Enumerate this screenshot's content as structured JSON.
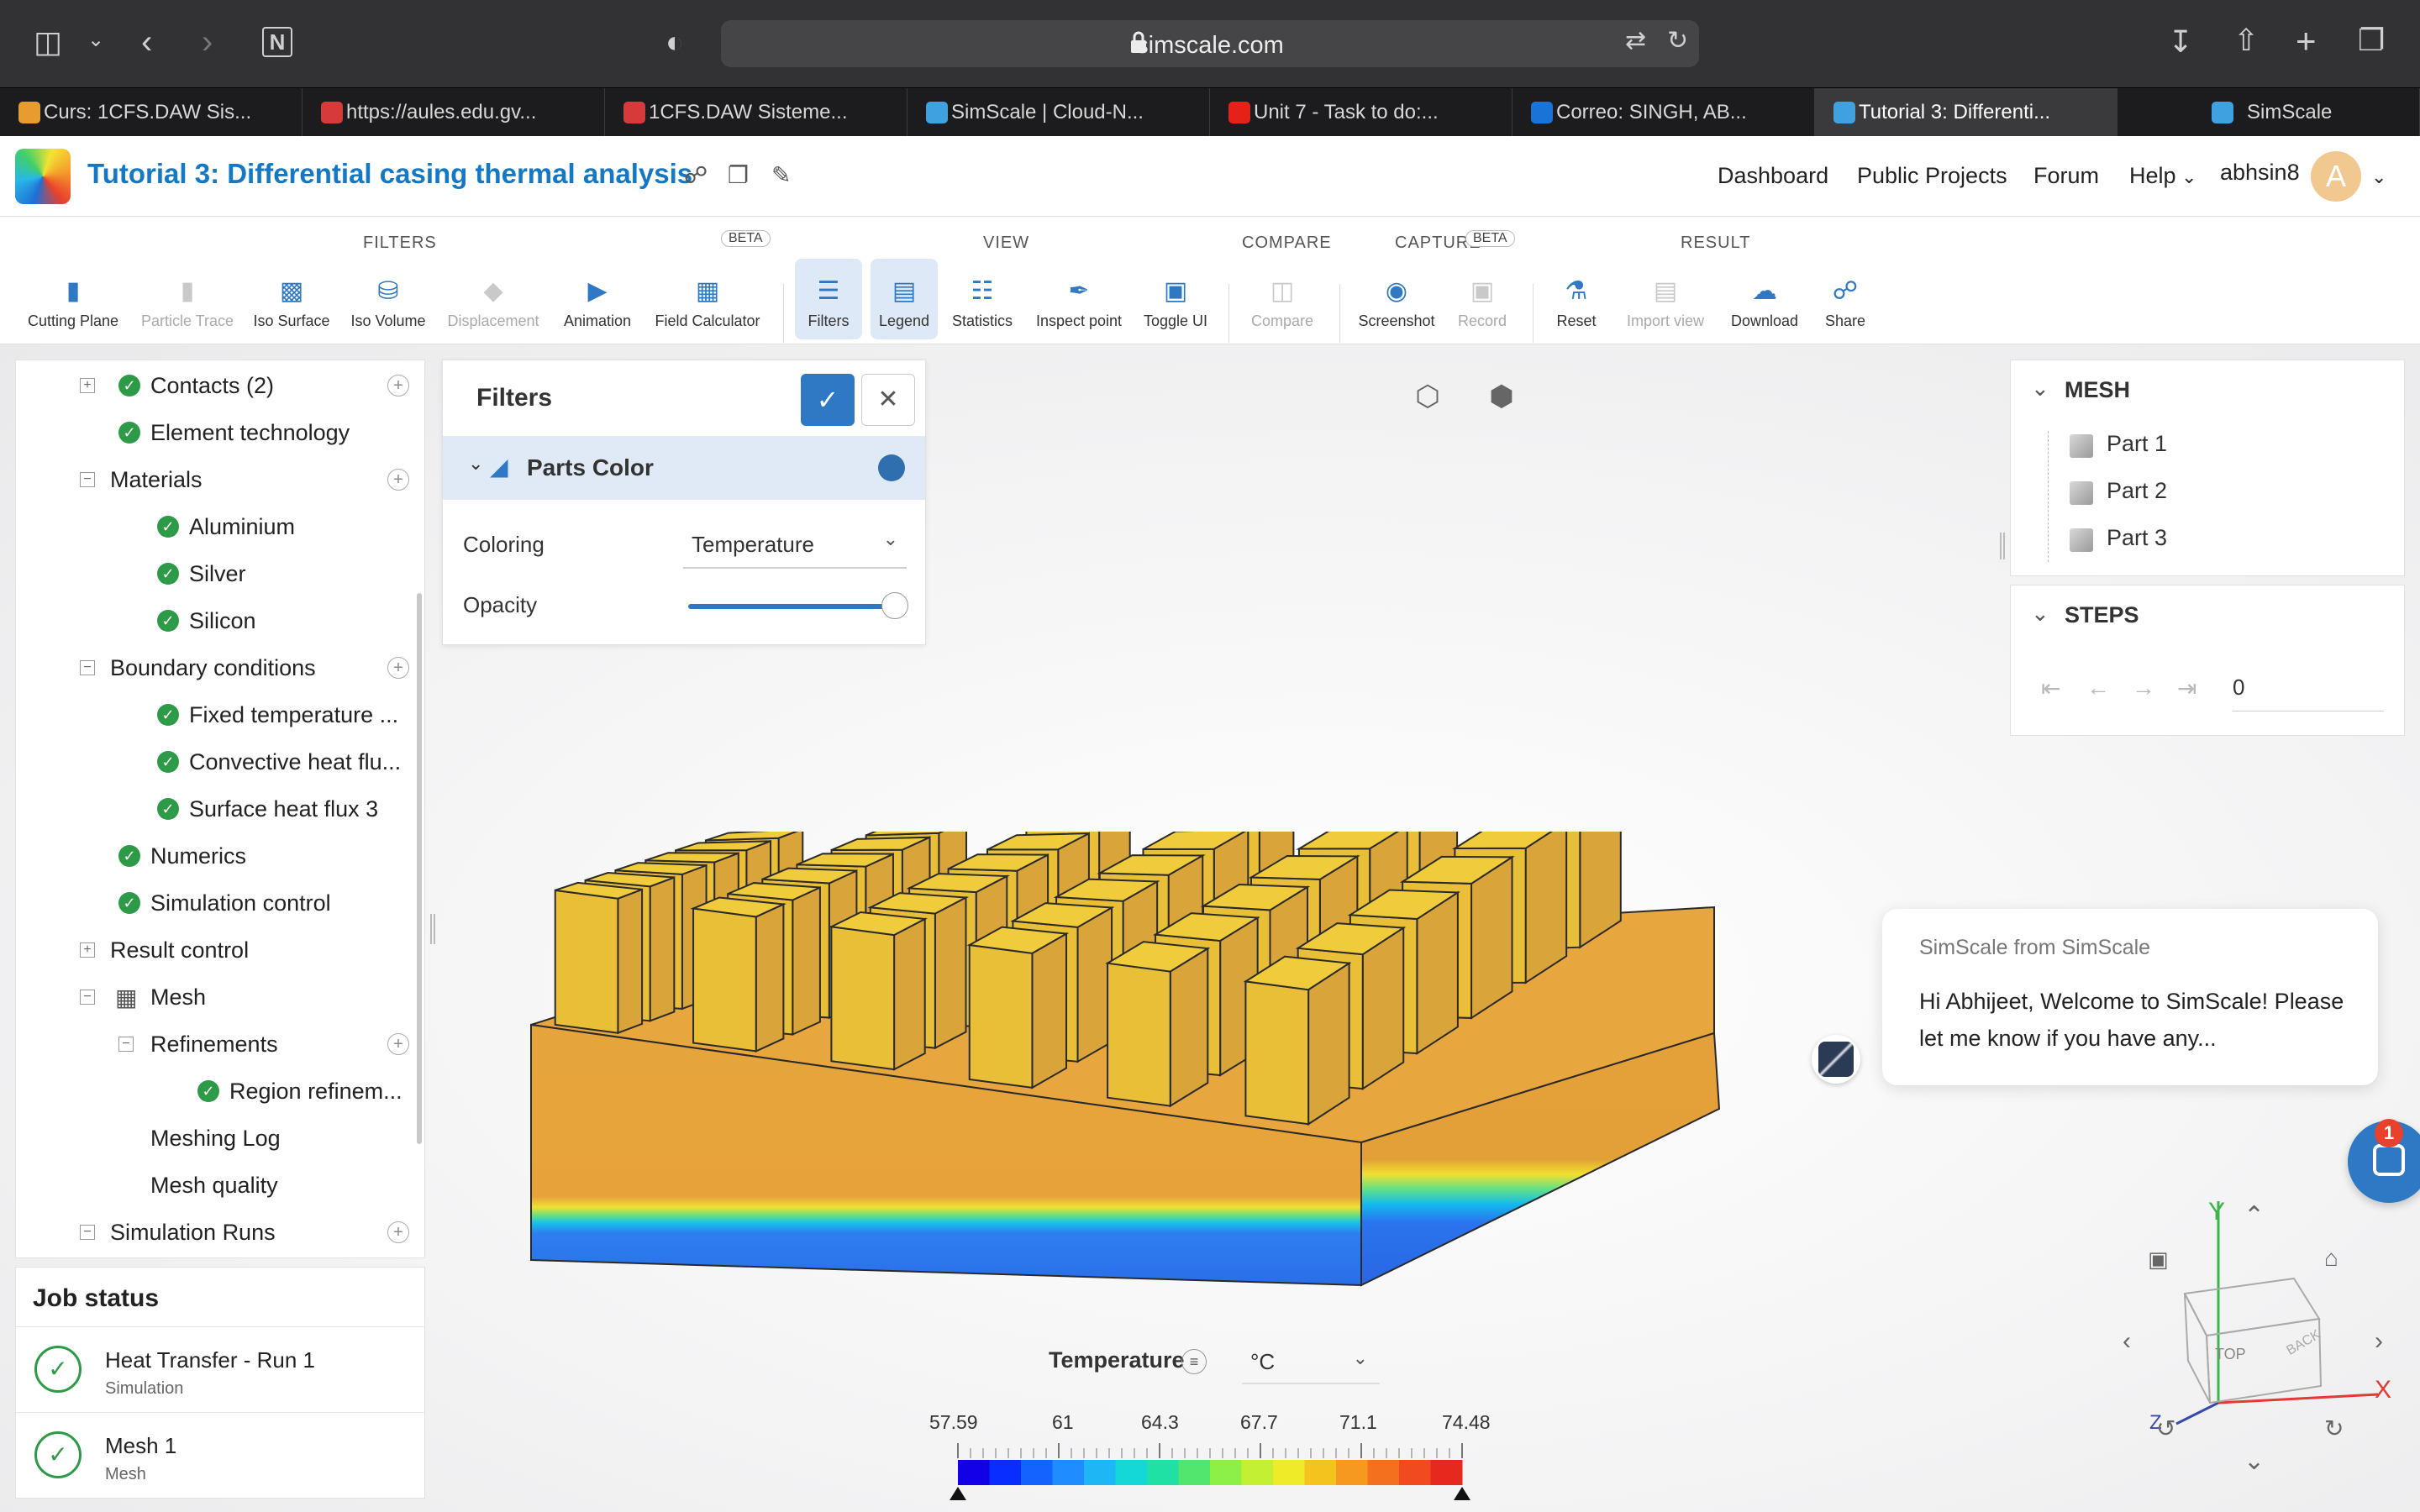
{
  "browser": {
    "url": "simscale.com",
    "tabs": [
      {
        "label": "Curs: 1CFS.DAW Sis...",
        "color": "#e89b2e"
      },
      {
        "label": "https://aules.edu.gv...",
        "color": "#d73a3a"
      },
      {
        "label": "1CFS.DAW Sisteme...",
        "color": "#d73a3a"
      },
      {
        "label": "SimScale | Cloud-N...",
        "color": "#3fa1e0"
      },
      {
        "label": "Unit 7 - Task to do:...",
        "color": "#e62117"
      },
      {
        "label": "Correo: SINGH, AB...",
        "color": "#1a73d6"
      },
      {
        "label": "Tutorial 3: Differenti...",
        "color": "#3fa1e0"
      },
      {
        "label": "SimScale",
        "color": "#3fa1e0"
      }
    ],
    "active_tab_index": 6
  },
  "header": {
    "title": "Tutorial 3: Differential casing thermal analysis",
    "nav": [
      "Dashboard",
      "Public Projects",
      "Forum",
      "Help"
    ],
    "username": "abhsin8",
    "avatar_letter": "A"
  },
  "toolbar": {
    "groups": {
      "filters": "FILTERS",
      "view": "VIEW",
      "compare": "COMPARE",
      "capture": "CAPTURE",
      "result": "RESULT"
    },
    "beta": "BETA",
    "tools": {
      "cutting_plane": "Cutting Plane",
      "particle_trace": "Particle Trace",
      "iso_surface": "Iso Surface",
      "iso_volume": "Iso Volume",
      "displacement": "Displacement",
      "animation": "Animation",
      "field_calculator": "Field Calculator",
      "filters": "Filters",
      "legend": "Legend",
      "statistics": "Statistics",
      "inspect_point": "Inspect point",
      "toggle_ui": "Toggle UI",
      "compare": "Compare",
      "screenshot": "Screenshot",
      "record": "Record",
      "reset": "Reset",
      "import_view": "Import view",
      "download": "Download",
      "share": "Share"
    }
  },
  "tree": {
    "contacts": "Contacts (2)",
    "element_technology": "Element technology",
    "materials": "Materials",
    "aluminium": "Aluminium",
    "silver": "Silver",
    "silicon": "Silicon",
    "boundary_conditions": "Boundary conditions",
    "fixed_temperature": "Fixed temperature ...",
    "convective_heat": "Convective heat flu...",
    "surface_heat_flux": "Surface heat flux 3",
    "numerics": "Numerics",
    "simulation_control": "Simulation control",
    "result_control": "Result control",
    "mesh": "Mesh",
    "refinements": "Refinements",
    "region_refinement": "Region refinem...",
    "meshing_log": "Meshing Log",
    "mesh_quality": "Mesh quality",
    "simulation_runs": "Simulation Runs"
  },
  "job_status": {
    "title": "Job status",
    "items": [
      {
        "name": "Heat Transfer - Run 1",
        "type": "Simulation"
      },
      {
        "name": "Mesh 1",
        "type": "Mesh"
      }
    ]
  },
  "filters_panel": {
    "title": "Filters",
    "section": "Parts Color",
    "coloring_label": "Coloring",
    "coloring_value": "Temperature",
    "opacity_label": "Opacity",
    "opacity": 1.0
  },
  "mesh_panel": {
    "title": "MESH",
    "parts": [
      "Part 1",
      "Part 2",
      "Part 3"
    ]
  },
  "steps_panel": {
    "title": "STEPS",
    "step": "0"
  },
  "chat": {
    "from": "SimScale from SimScale",
    "message": "Hi Abhijeet, Welcome to SimScale! Please let me know if you have any...",
    "badge": "1"
  },
  "legend": {
    "title": "Temperature",
    "unit": "°C",
    "ticks": [
      "57.59",
      "61",
      "64.3",
      "67.7",
      "71.1",
      "74.48"
    ],
    "colors": [
      "#1400e6",
      "#0a2dff",
      "#1463ff",
      "#1f8cff",
      "#1fb6f5",
      "#14d7d7",
      "#1fe0a5",
      "#52e66e",
      "#8cf046",
      "#c3f032",
      "#f0eb28",
      "#f5c31e",
      "#f59a1e",
      "#f5701e",
      "#f04a1e",
      "#e6281e"
    ]
  },
  "gizmo": {
    "y": "Y",
    "x": "X",
    "z": "Z",
    "top": "TOP",
    "back": "BACK"
  }
}
